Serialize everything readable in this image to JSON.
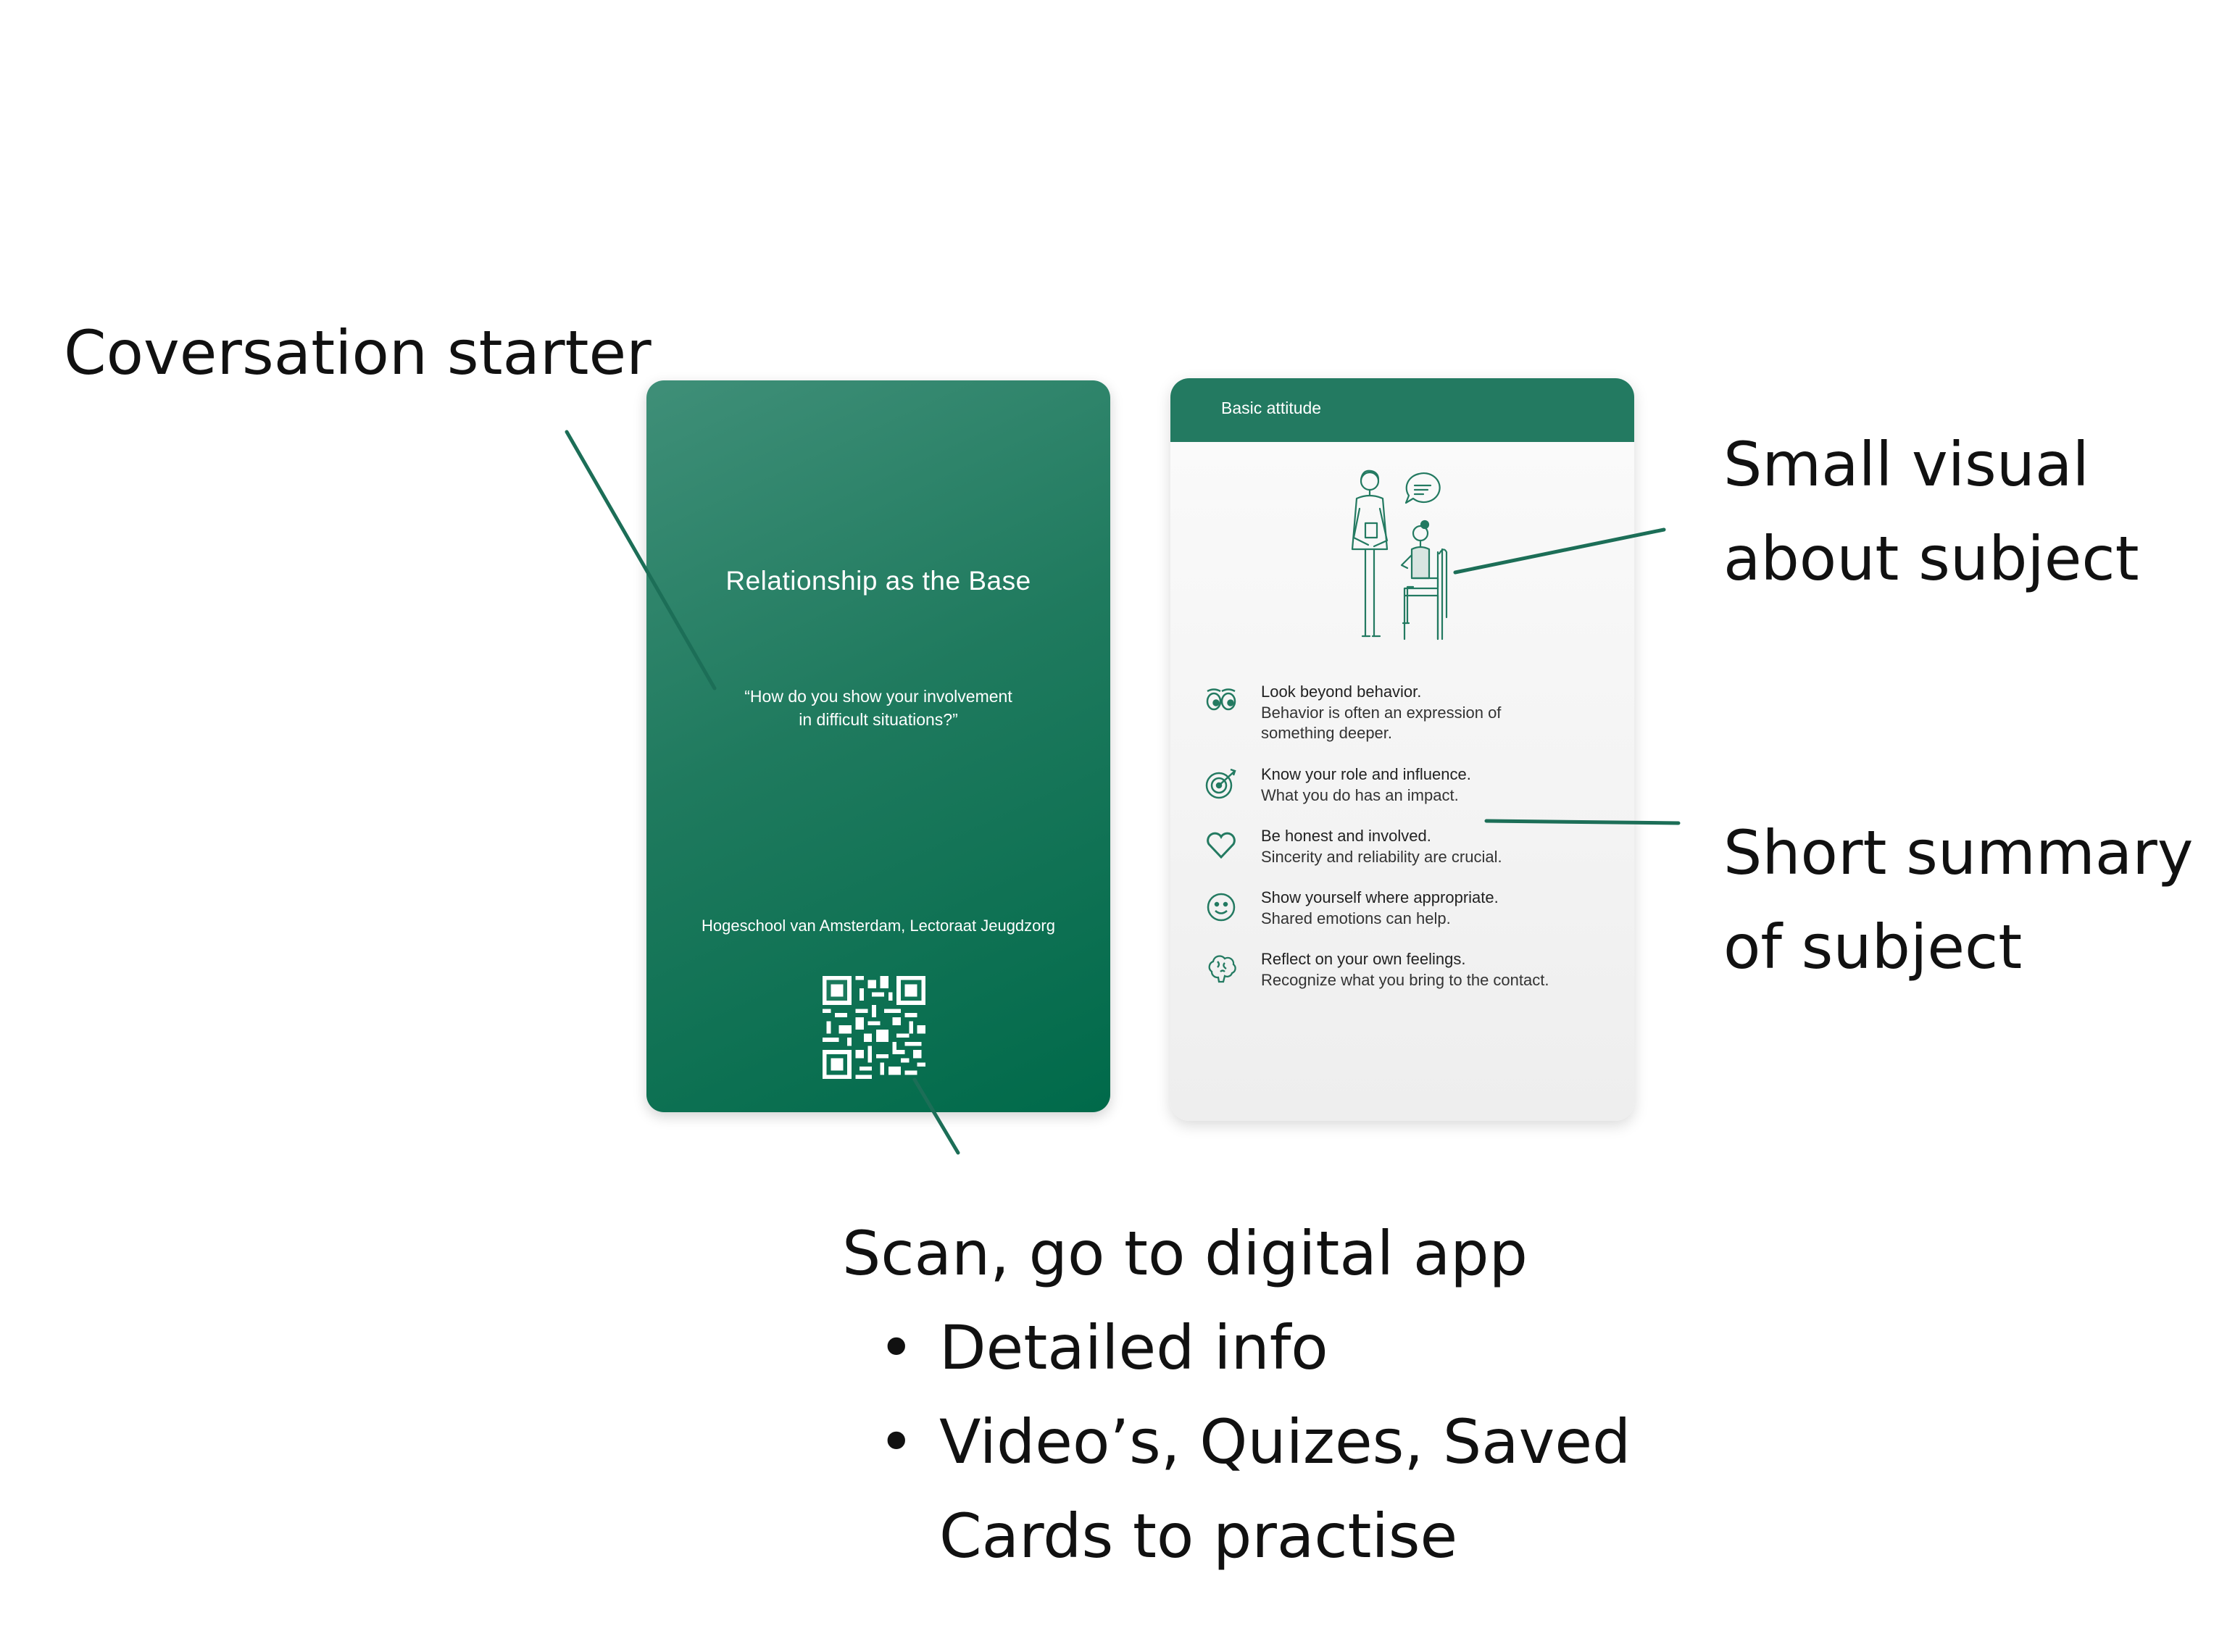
{
  "annotations": {
    "conversation_starter": "Coversation starter",
    "small_visual_line1": "Small visual",
    "small_visual_line2": "about subject",
    "short_summary_line1": "Short summary",
    "short_summary_line2": "of subject",
    "scan_title": "Scan, go to digital app",
    "scan_bullets": [
      "Detailed info",
      "Video’s, Quizes, Saved"
    ],
    "scan_continuation": "Cards to practise",
    "bullet_symbol": "•"
  },
  "front_card": {
    "title": "Relationship as the Base",
    "quote_line1": "“How do you show your involvement",
    "quote_line2": "in difficult situations?”",
    "footer": "Hogeschool van Amsterdam, Lectoraat Jeugdzorg"
  },
  "back_card": {
    "header": "Basic attitude",
    "items": [
      {
        "icon": "eyes-icon",
        "title": "Look beyond behavior.",
        "desc": "Behavior is often an expression of something deeper."
      },
      {
        "icon": "target-icon",
        "title": "Know your role and influence.",
        "desc": "What you do has an impact."
      },
      {
        "icon": "heart-icon",
        "title": "Be honest and involved.",
        "desc": "Sincerity and reliability are crucial."
      },
      {
        "icon": "smiley-icon",
        "title": "Show yourself where appropriate.",
        "desc": "Shared emotions can help."
      },
      {
        "icon": "brain-icon",
        "title": "Reflect on your own feelings.",
        "desc": "Recognize what you bring to the contact."
      }
    ]
  },
  "colors": {
    "brand_green": "#237a61",
    "card_green_dark": "#006a4a",
    "line_green": "#1c6e57"
  }
}
